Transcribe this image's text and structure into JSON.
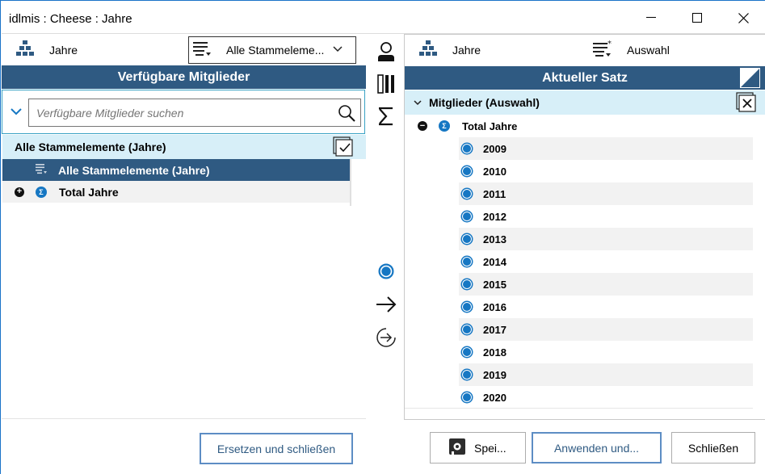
{
  "window": {
    "title": "idlmis : Cheese : Jahre",
    "controls": {
      "minimize": "—",
      "maximize": "☐",
      "close": "✕"
    }
  },
  "left": {
    "dimension_label": "Jahre",
    "dropdown_value": "Alle Stammeleme...",
    "panel_title": "Verfügbare Mitglieder",
    "search_placeholder": "Verfügbare Mitglieder suchen",
    "group_label": "Alle Stammelemente (Jahre)",
    "items": [
      {
        "label": "Alle Stammelemente (Jahre)",
        "selected": true
      },
      {
        "label": "Total Jahre",
        "selected": false
      }
    ]
  },
  "right": {
    "dimension_label": "Jahre",
    "selection_label": "Auswahl",
    "panel_title": "Aktueller Satz",
    "group_label": "Mitglieder (Auswahl)",
    "total_label": "Total Jahre",
    "years": [
      "2009",
      "2010",
      "2011",
      "2012",
      "2013",
      "2014",
      "2015",
      "2016",
      "2017",
      "2018",
      "2019",
      "2020"
    ]
  },
  "buttons": {
    "replace_close": "Ersetzen und schließen",
    "save": "Spei...",
    "apply": "Anwenden und...",
    "close": "Schließen"
  },
  "colors": {
    "header_blue": "#2f5a82",
    "light_row": "#d7eff8",
    "accent": "#1677c3",
    "border_blue": "#1a73c8"
  }
}
